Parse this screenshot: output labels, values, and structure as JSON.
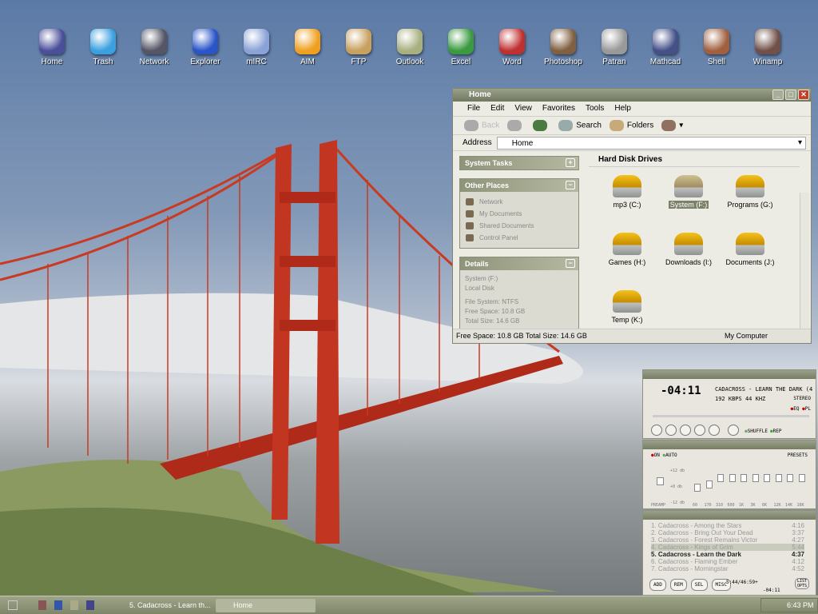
{
  "desktop_icons": [
    {
      "label": "Home",
      "color": "#4a4f9a"
    },
    {
      "label": "Trash",
      "color": "#3aa0e0"
    },
    {
      "label": "Network",
      "color": "#556"
    },
    {
      "label": "Explorer",
      "color": "#2a55c8"
    },
    {
      "label": "mIRC",
      "color": "#8aa2d8"
    },
    {
      "label": "AIM",
      "color": "#f0a020"
    },
    {
      "label": "FTP",
      "color": "#c8a060"
    },
    {
      "label": "Outlook",
      "color": "#a8b080"
    },
    {
      "label": "Excel",
      "color": "#3a9a40"
    },
    {
      "label": "Word",
      "color": "#c03030"
    },
    {
      "label": "Photoshop",
      "color": "#806040"
    },
    {
      "label": "Patran",
      "color": "#999"
    },
    {
      "label": "Mathcad",
      "color": "#445088"
    },
    {
      "label": "Shell",
      "color": "#a06040"
    },
    {
      "label": "Winamp",
      "color": "#705048"
    }
  ],
  "explorer": {
    "title": "Home",
    "menu": [
      "File",
      "Edit",
      "View",
      "Favorites",
      "Tools",
      "Help"
    ],
    "toolbar": {
      "back": "Back",
      "search": "Search",
      "folders": "Folders"
    },
    "address_label": "Address",
    "address_value": "Home",
    "system_tasks": "System Tasks",
    "other_places": {
      "title": "Other Places",
      "items": [
        "Network",
        "My Documents",
        "Shared Documents",
        "Control Panel"
      ]
    },
    "details": {
      "title": "Details",
      "lines": [
        "System (F:)",
        "Local Disk",
        "File System: NTFS",
        "Free Space: 10.8 GB",
        "Total Size: 14.6 GB"
      ]
    },
    "section": "Hard Disk Drives",
    "drives": [
      "mp3 (C:)",
      "System (F:)",
      "Programs (G:)",
      "Games (H:)",
      "Downloads (I:)",
      "Documents (J:)",
      "Temp (K:)"
    ],
    "selected_drive": 1,
    "status_left": "Free Space: 10.8 GB Total Size: 14.6 GB",
    "status_right": "My Computer"
  },
  "winamp": {
    "time": "-04:11",
    "track": "CADACROSS - LEARN THE DARK (4",
    "kbps": "192",
    "kbps_label": "KBPS",
    "khz": "44",
    "khz_label": "KHZ",
    "stereo": "STEREO",
    "eq": "EQ",
    "pl": "PL",
    "shuffle": "SHUFFLE",
    "rep": "REP",
    "eq_on": "ON",
    "eq_auto": "AUTO",
    "presets": "PRESETS",
    "db_top": "+12 db",
    "db_mid": "+0 db",
    "db_bot": "-12 db",
    "preamp": "PREAMP",
    "bands": [
      "60",
      "170",
      "310",
      "600",
      "1K",
      "3K",
      "6K",
      "12K",
      "14K",
      "16K"
    ],
    "band_levels": [
      -2,
      -1,
      1,
      1,
      1,
      1,
      1,
      1,
      1,
      1
    ],
    "playlist": [
      [
        "1. Cadacross - Among the Stars",
        "4:16"
      ],
      [
        "2. Cadacross - Bring Out Your Dead",
        "3:37"
      ],
      [
        "3. Cadacross - Forest Remains Victor",
        "4:27"
      ],
      [
        "4. Cadacross - Kings of Grim",
        "5:44"
      ],
      [
        "5. Cadacross - Learn the Dark",
        "4:37"
      ],
      [
        "6. Cadacross - Flaming Ember",
        "4:12"
      ],
      [
        "7. Cadacross - Morningstar",
        "4:52"
      ]
    ],
    "current": 4,
    "selected": 3,
    "buttons": [
      "ADD",
      "REM",
      "SEL",
      "MISC"
    ],
    "list_opts": "LIST OPTS",
    "total": "5:44/46:59+",
    "remaining": "-04:11"
  },
  "taskbar": {
    "tasks": [
      "5. Cadacross - Learn th...",
      "Home"
    ],
    "clock": "6:43 PM"
  }
}
